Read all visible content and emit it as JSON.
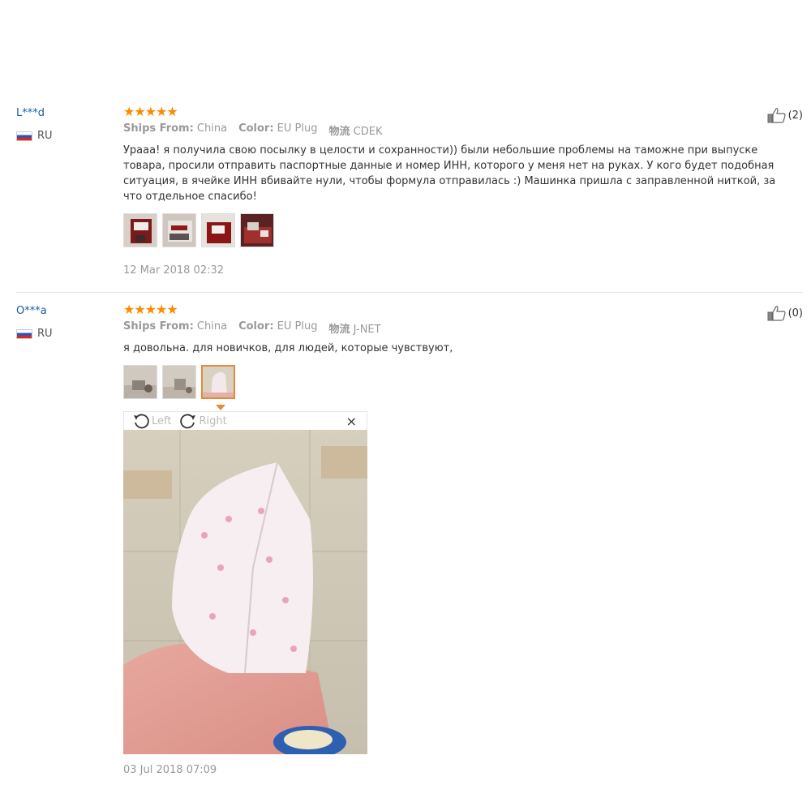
{
  "reviews": [
    {
      "user": "L***d",
      "country": "RU",
      "stars": 5,
      "ships_label": "Ships From:",
      "ships_value": "China",
      "color_label": "Color:",
      "color_value": "EU Plug",
      "logistics_label": "物流",
      "logistics_value": "CDEK",
      "text": "Урааа! я получила свою посылку в целости и сохранности)) были небольшие проблемы на таможне при выпуске товара, просили отправить паспортные данные и номер ИНН, которого у меня нет на руках. У кого будет подобная ситуация, в ячейке ИНН вбивайте нули, чтобы формула отправилась :) Машинка пришла с заправленной ниткой, за что отдельное спасибо!",
      "likes": "(2)",
      "date": "12 Mar 2018 02:32",
      "photo_count": 4
    },
    {
      "user": "O***a",
      "country": "RU",
      "stars": 5,
      "ships_label": "Ships From:",
      "ships_value": "China",
      "color_label": "Color:",
      "color_value": "EU Plug",
      "logistics_label": "物流",
      "logistics_value": "J-NET",
      "text": "я довольна. для новичков, для людей, которые чувствуют,",
      "likes": "(0)",
      "date": "03 Jul 2018 07:09",
      "photo_count": 3,
      "selected_photo": 3
    }
  ],
  "viewer": {
    "rotate_left": "Left",
    "rotate_right": "Right",
    "close": "×"
  },
  "colors": {
    "star": "#ff8a00",
    "username": "#1a5aa6",
    "selected_border": "#e58a38"
  }
}
